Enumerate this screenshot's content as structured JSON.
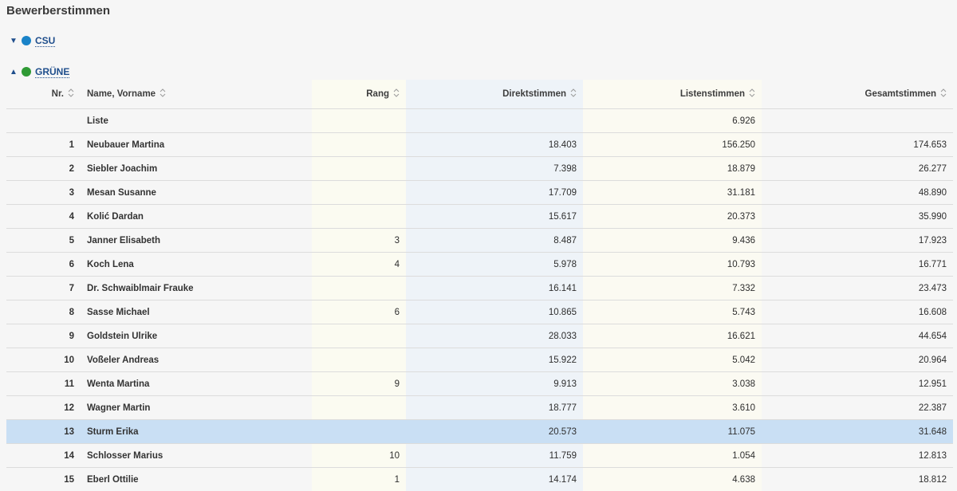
{
  "page": {
    "title": "Bewerberstimmen"
  },
  "parties": [
    {
      "name": "CSU",
      "expanded": false,
      "color": "#1a83c8",
      "toggle_icon": "triangle-down"
    },
    {
      "name": "GRÜNE",
      "expanded": true,
      "color": "#2f9a35",
      "toggle_icon": "triangle-up"
    }
  ],
  "table": {
    "headers": {
      "nr": "Nr.",
      "name": "Name, Vorname",
      "rang": "Rang",
      "direkt": "Direktstimmen",
      "listen": "Listenstimmen",
      "gesamt": "Gesamtstimmen"
    },
    "rows": [
      {
        "nr": "",
        "name": "Liste",
        "rang": "",
        "direkt": "",
        "listen": "6.926",
        "gesamt": ""
      },
      {
        "nr": "1",
        "name": "Neubauer Martina",
        "rang": "",
        "direkt": "18.403",
        "listen": "156.250",
        "gesamt": "174.653"
      },
      {
        "nr": "2",
        "name": "Siebler Joachim",
        "rang": "",
        "direkt": "7.398",
        "listen": "18.879",
        "gesamt": "26.277"
      },
      {
        "nr": "3",
        "name": "Mesan Susanne",
        "rang": "",
        "direkt": "17.709",
        "listen": "31.181",
        "gesamt": "48.890"
      },
      {
        "nr": "4",
        "name": "Kolić Dardan",
        "rang": "",
        "direkt": "15.617",
        "listen": "20.373",
        "gesamt": "35.990"
      },
      {
        "nr": "5",
        "name": "Janner Elisabeth",
        "rang": "3",
        "direkt": "8.487",
        "listen": "9.436",
        "gesamt": "17.923"
      },
      {
        "nr": "6",
        "name": "Koch Lena",
        "rang": "4",
        "direkt": "5.978",
        "listen": "10.793",
        "gesamt": "16.771"
      },
      {
        "nr": "7",
        "name": "Dr. Schwaiblmair Frauke",
        "rang": "",
        "direkt": "16.141",
        "listen": "7.332",
        "gesamt": "23.473"
      },
      {
        "nr": "8",
        "name": "Sasse Michael",
        "rang": "6",
        "direkt": "10.865",
        "listen": "5.743",
        "gesamt": "16.608"
      },
      {
        "nr": "9",
        "name": "Goldstein Ulrike",
        "rang": "",
        "direkt": "28.033",
        "listen": "16.621",
        "gesamt": "44.654"
      },
      {
        "nr": "10",
        "name": "Voßeler Andreas",
        "rang": "",
        "direkt": "15.922",
        "listen": "5.042",
        "gesamt": "20.964"
      },
      {
        "nr": "11",
        "name": "Wenta Martina",
        "rang": "9",
        "direkt": "9.913",
        "listen": "3.038",
        "gesamt": "12.951"
      },
      {
        "nr": "12",
        "name": "Wagner Martin",
        "rang": "",
        "direkt": "18.777",
        "listen": "3.610",
        "gesamt": "22.387"
      },
      {
        "nr": "13",
        "name": "Sturm Erika",
        "rang": "",
        "direkt": "20.573",
        "listen": "11.075",
        "gesamt": "31.648",
        "highlighted": true
      },
      {
        "nr": "14",
        "name": "Schlosser Marius",
        "rang": "10",
        "direkt": "11.759",
        "listen": "1.054",
        "gesamt": "12.813"
      },
      {
        "nr": "15",
        "name": "Eberl Ottilie",
        "rang": "1",
        "direkt": "14.174",
        "listen": "4.638",
        "gesamt": "18.812"
      }
    ]
  },
  "colors": {
    "link": "#1f4e8c",
    "highlight_row": "#c9dff4"
  }
}
